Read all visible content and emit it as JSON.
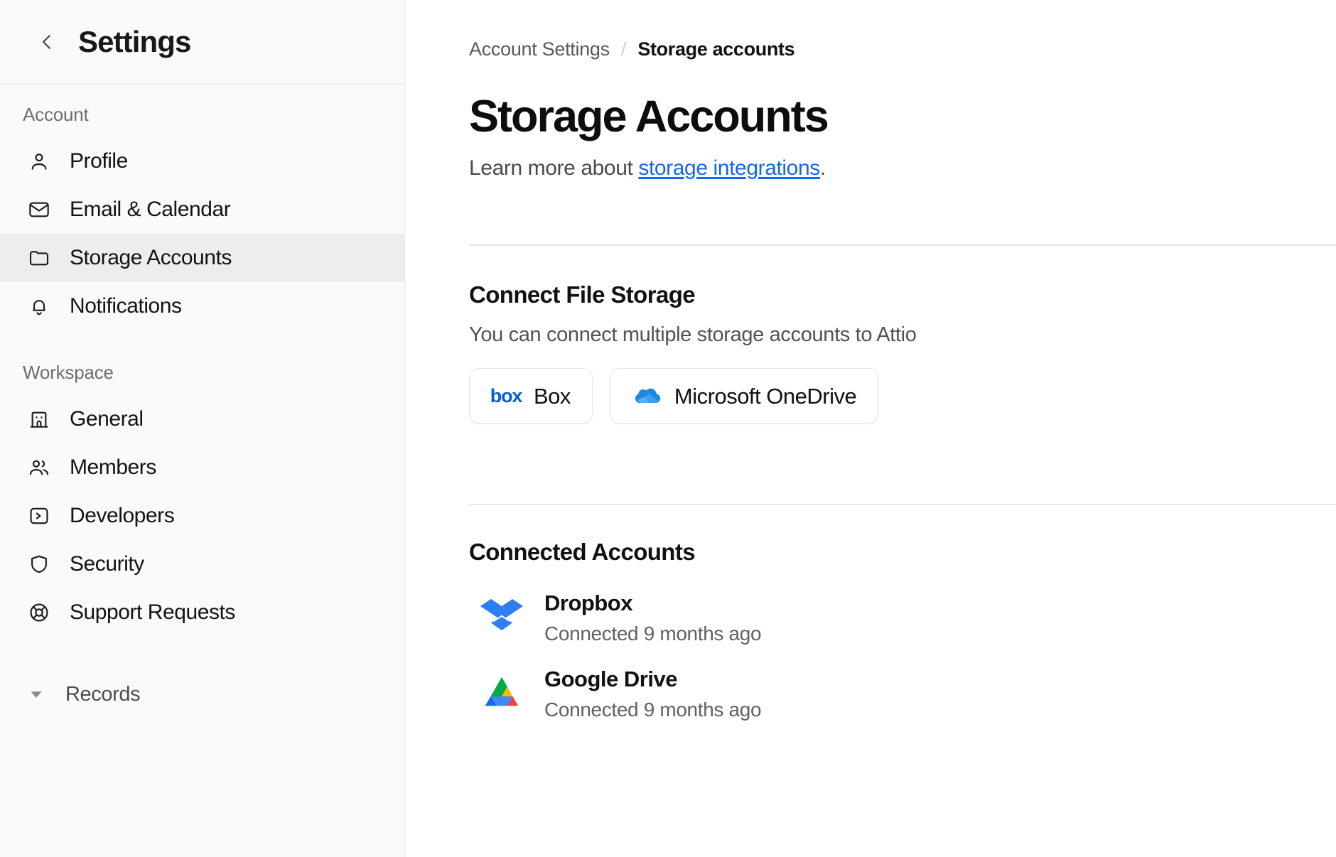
{
  "sidebar": {
    "title": "Settings",
    "back_icon": "chevron-left-icon",
    "groups": [
      {
        "label": "Account",
        "items": [
          {
            "label": "Profile",
            "icon": "user-icon",
            "active": false
          },
          {
            "label": "Email & Calendar",
            "icon": "envelope-icon",
            "active": false
          },
          {
            "label": "Storage Accounts",
            "icon": "folder-icon",
            "active": true
          },
          {
            "label": "Notifications",
            "icon": "bell-icon",
            "active": false
          }
        ]
      },
      {
        "label": "Workspace",
        "items": [
          {
            "label": "General",
            "icon": "building-icon",
            "active": false
          },
          {
            "label": "Members",
            "icon": "users-icon",
            "active": false
          },
          {
            "label": "Developers",
            "icon": "terminal-icon",
            "active": false
          },
          {
            "label": "Security",
            "icon": "shield-icon",
            "active": false
          },
          {
            "label": "Support Requests",
            "icon": "lifebuoy-icon",
            "active": false
          }
        ]
      }
    ],
    "records": {
      "label": "Records",
      "caret_icon": "caret-down-icon",
      "expanded": true
    }
  },
  "breadcrumb": {
    "parent": "Account Settings",
    "separator": "/",
    "current": "Storage accounts"
  },
  "page": {
    "title": "Storage Accounts",
    "subtitle_prefix": "Learn more about ",
    "subtitle_link": "storage integrations",
    "subtitle_suffix": "."
  },
  "connect_section": {
    "title": "Connect File Storage",
    "description": "You can connect multiple storage accounts to Attio",
    "providers": [
      {
        "name": "Box",
        "logo": "box-logo-icon",
        "wordmark": "box",
        "color": "#0061d5"
      },
      {
        "name": "Microsoft OneDrive",
        "logo": "onedrive-logo-icon",
        "color": "#0f78d4"
      }
    ]
  },
  "connected_section": {
    "title": "Connected Accounts",
    "accounts": [
      {
        "name": "Dropbox",
        "status": "Connected 9 months ago",
        "logo": "dropbox-logo-icon",
        "color": "#2d7ff0"
      },
      {
        "name": "Google Drive",
        "status": "Connected 9 months ago",
        "logo": "google-drive-logo-icon",
        "color": "#00ac47"
      }
    ]
  },
  "colors": {
    "link": "#1668e3",
    "sidebar_bg": "#fafafa",
    "active_item_bg": "#ededed",
    "divider": "#e8e8e8",
    "text_primary": "#111111",
    "text_secondary": "#5a5a5a"
  }
}
